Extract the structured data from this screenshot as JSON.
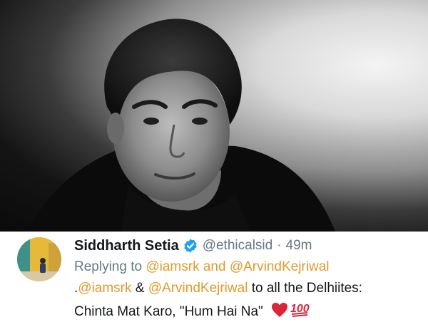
{
  "tweet": {
    "display_name": "Siddharth Setia",
    "handle": "@ethicalsid",
    "separator": "·",
    "time": "49m",
    "replying_prefix": "Replying to",
    "replying_to": "@iamsrk and @ArvindKejriwal",
    "body": {
      "line1_prefix": ".",
      "mention1": "@iamsrk",
      "ampersand": " & ",
      "mention2": "@ArvindKejriwal",
      "line1_suffix": " to all the Delhiites:",
      "line2": "Chinta Mat Karo, \"Hum Hai Na\""
    }
  },
  "icons": {
    "verified": "verified-badge-icon",
    "heart": "red-heart-emoji",
    "hundred": "hundred-points-emoji"
  },
  "colors": {
    "mention": "#e09a2c",
    "muted": "#657786",
    "text": "#14171a",
    "verified": "#1da1f2",
    "heart": "#d9263a"
  }
}
